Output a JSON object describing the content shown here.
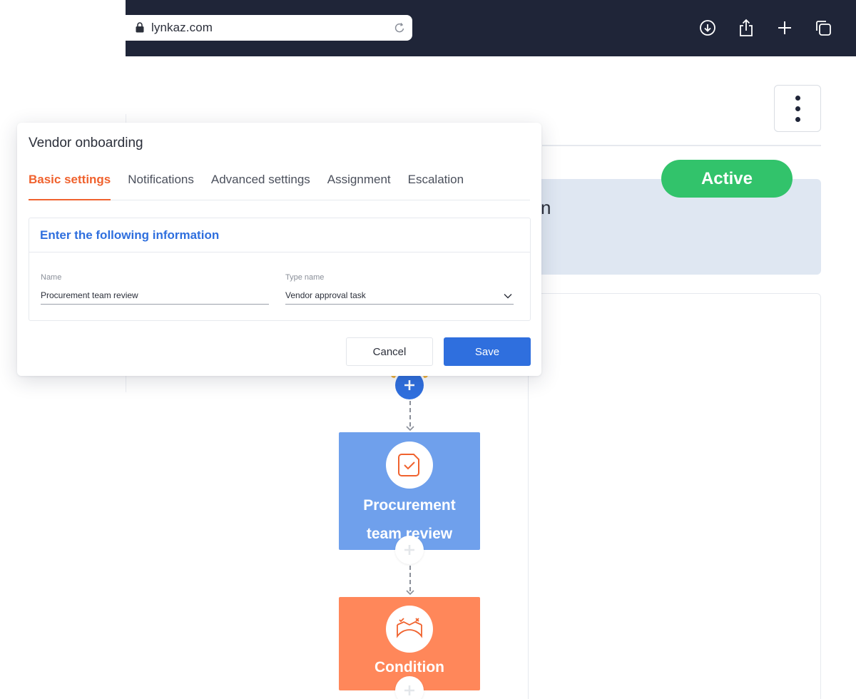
{
  "browser": {
    "url": "lynkaz.com",
    "icons": [
      "lock-icon",
      "reload-icon",
      "download-icon",
      "share-icon",
      "new-tab-icon",
      "tabs-icon"
    ]
  },
  "app": {
    "status_badge": "Active",
    "info_text_fragment": "n",
    "colors": {
      "active": "#32c36b",
      "primary": "#2f6fde",
      "accent_orange": "#f0622e",
      "task_node": "#6fa0ec",
      "condition_node": "#ff875a"
    }
  },
  "flow": {
    "nodes": [
      {
        "title": "Procurement team review",
        "icon": "task-check-icon"
      },
      {
        "title": "Condition",
        "icon": "condition-icon"
      }
    ]
  },
  "modal": {
    "title": "Vendor onboarding",
    "tabs": [
      {
        "label": "Basic settings",
        "active": true
      },
      {
        "label": "Notifications",
        "active": false
      },
      {
        "label": "Advanced settings",
        "active": false
      },
      {
        "label": "Assignment",
        "active": false
      },
      {
        "label": "Escalation",
        "active": false
      }
    ],
    "section_heading": "Enter the following information",
    "fields": {
      "name": {
        "label": "Name",
        "value": "Procurement team review"
      },
      "type": {
        "label": "Type name",
        "value": "Vendor approval task"
      }
    },
    "cancel_label": "Cancel",
    "save_label": "Save"
  }
}
